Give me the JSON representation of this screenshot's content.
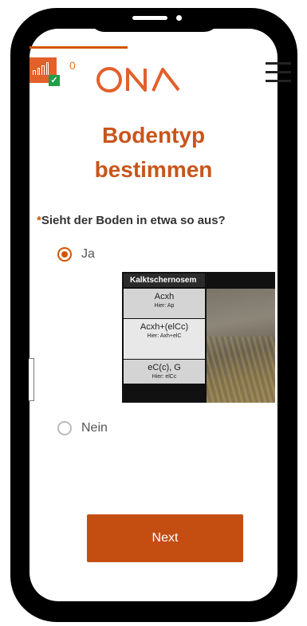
{
  "header": {
    "badge_count": "0",
    "logo_text": "ONA"
  },
  "page": {
    "title_line1": "Bodentyp",
    "title_line2": "bestimmen"
  },
  "question": {
    "required_mark": "*",
    "text": "Sieht der Boden in etwa so aus?",
    "options": [
      {
        "label": "Ja",
        "selected": true
      },
      {
        "label": "Nein",
        "selected": false
      }
    ]
  },
  "soil_image": {
    "heading": "Kalktschernosem",
    "layers": [
      {
        "name": "Acxh",
        "hier": "Hier: Ap"
      },
      {
        "name": "Acxh+(elCc)",
        "hier": "Hier: Axh+elC"
      },
      {
        "name": "eC(c), G",
        "hier": "Hier: elCc"
      }
    ]
  },
  "footer": {
    "next_label": "Next"
  },
  "colors": {
    "accent": "#d35400",
    "button": "#c44d12",
    "badge_ok": "#1da04a"
  }
}
